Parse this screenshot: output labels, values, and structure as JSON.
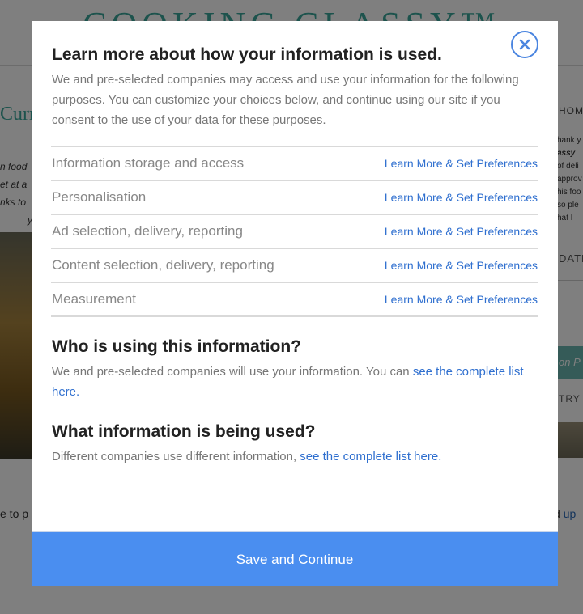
{
  "background": {
    "logo": "COOKING CLASSY™",
    "title_fragment": "Curry",
    "italic_left": [
      "n food",
      "et at a",
      "nks to",
      "y"
    ],
    "text_left": "e to p",
    "home_fragment": "HOME",
    "italic_right": [
      "hank y",
      "assy",
      "of deli",
      "approv",
      "his foo",
      "so ple",
      "hat I"
    ],
    "date_fragment": "DATE",
    "button_fragment": "on P",
    "try_fragment": "TRY",
    "text_right": "d",
    "text_right_link": "up"
  },
  "modal": {
    "title": "Learn more about how your information is used.",
    "intro": "We and pre-selected companies may access and use your information for the following purposes. You can customize your choices below, and continue using our site if you consent to the use of your data for these purposes.",
    "purposes": [
      {
        "name": "Information storage and access",
        "link": "Learn More & Set Preferences"
      },
      {
        "name": "Personalisation",
        "link": "Learn More & Set Preferences"
      },
      {
        "name": "Ad selection, delivery, reporting",
        "link": "Learn More & Set Preferences"
      },
      {
        "name": "Content selection, delivery, reporting",
        "link": "Learn More & Set Preferences"
      },
      {
        "name": "Measurement",
        "link": "Learn More & Set Preferences"
      }
    ],
    "who": {
      "heading": "Who is using this information?",
      "text": "We and pre-selected companies will use your information. You can ",
      "link": "see the complete list here."
    },
    "what": {
      "heading": "What information is being used?",
      "text": "Different companies use different information, ",
      "link": "see the complete list here."
    },
    "save_label": "Save and Continue",
    "close_icon": "close-x-icon"
  },
  "colors": {
    "accent": "#4a8ef0",
    "link": "#2f6fcf",
    "close_ring": "#4a85e0",
    "overlay": "rgba(0,0,0,0.5)"
  }
}
